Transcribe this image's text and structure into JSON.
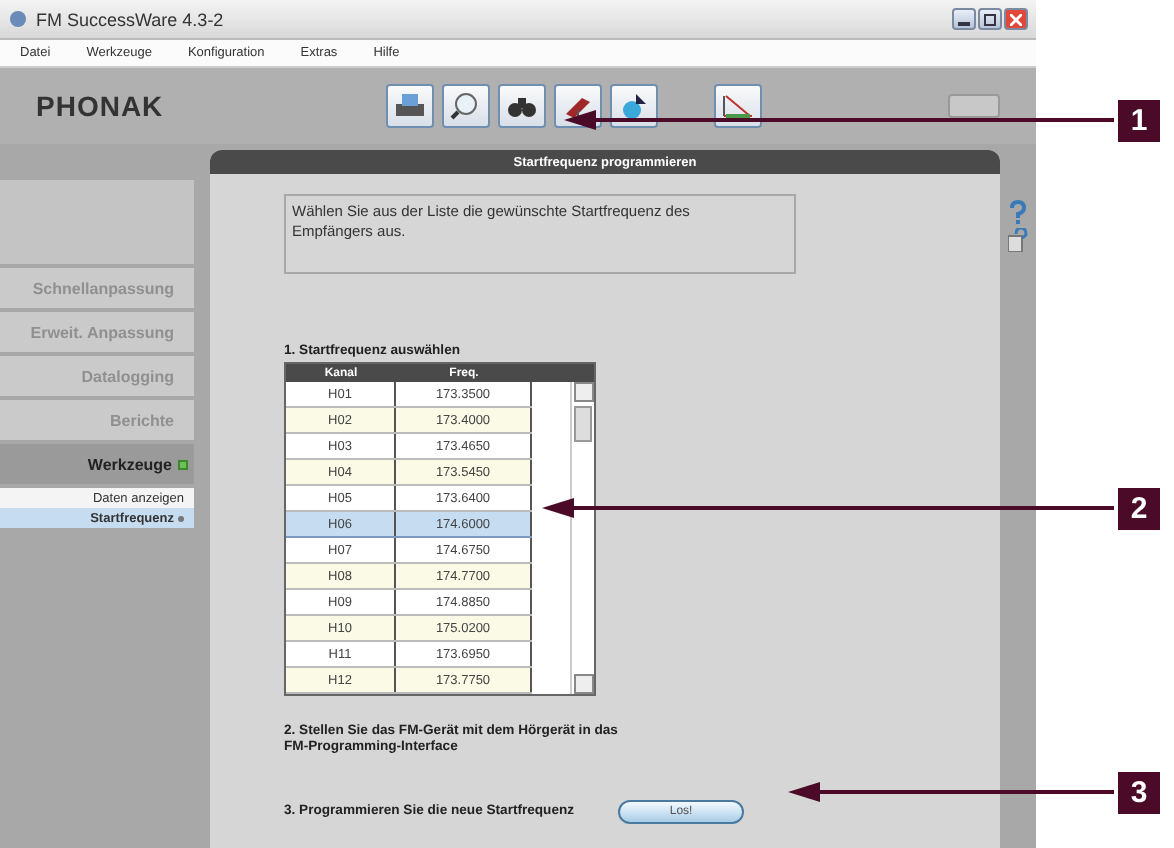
{
  "window": {
    "title": "FM SuccessWare 4.3-2"
  },
  "menu": [
    "Datei",
    "Werkzeuge",
    "Konfiguration",
    "Extras",
    "Hilfe"
  ],
  "logo": "PHONAK",
  "sidebar": {
    "items": [
      {
        "label": "Schnellanpassung",
        "selected": false
      },
      {
        "label": "Erweit. Anpassung",
        "selected": false
      },
      {
        "label": "Datalogging",
        "selected": false
      },
      {
        "label": "Berichte",
        "selected": false
      },
      {
        "label": "Werkzeuge",
        "selected": true,
        "children": [
          {
            "label": "Daten anzeigen",
            "selected": false
          },
          {
            "label": "Startfrequenz",
            "selected": true
          }
        ]
      }
    ]
  },
  "panel": {
    "title": "Startfrequenz programmieren",
    "instruction": "Wählen Sie aus der Liste die gewünschte Startfrequenz des Empfängers aus.",
    "step1": "1. Startfrequenz auswählen",
    "table": {
      "columns": [
        "Kanal",
        "Freq."
      ],
      "rows": [
        {
          "kanal": "H01",
          "freq": "173.3500",
          "selected": false
        },
        {
          "kanal": "H02",
          "freq": "173.4000",
          "selected": false
        },
        {
          "kanal": "H03",
          "freq": "173.4650",
          "selected": false
        },
        {
          "kanal": "H04",
          "freq": "173.5450",
          "selected": false
        },
        {
          "kanal": "H05",
          "freq": "173.6400",
          "selected": false
        },
        {
          "kanal": "H06",
          "freq": "174.6000",
          "selected": true
        },
        {
          "kanal": "H07",
          "freq": "174.6750",
          "selected": false
        },
        {
          "kanal": "H08",
          "freq": "174.7700",
          "selected": false
        },
        {
          "kanal": "H09",
          "freq": "174.8850",
          "selected": false
        },
        {
          "kanal": "H10",
          "freq": "175.0200",
          "selected": false
        },
        {
          "kanal": "H11",
          "freq": "173.6950",
          "selected": false
        },
        {
          "kanal": "H12",
          "freq": "173.7750",
          "selected": false
        }
      ]
    },
    "step2": "2. Stellen Sie das FM-Gerät mit dem Hörgerät in das FM-Programming-Interface",
    "step3": "3. Programmieren Sie die neue Startfrequenz",
    "button": "Los!"
  },
  "callouts": [
    "1",
    "2",
    "3"
  ]
}
